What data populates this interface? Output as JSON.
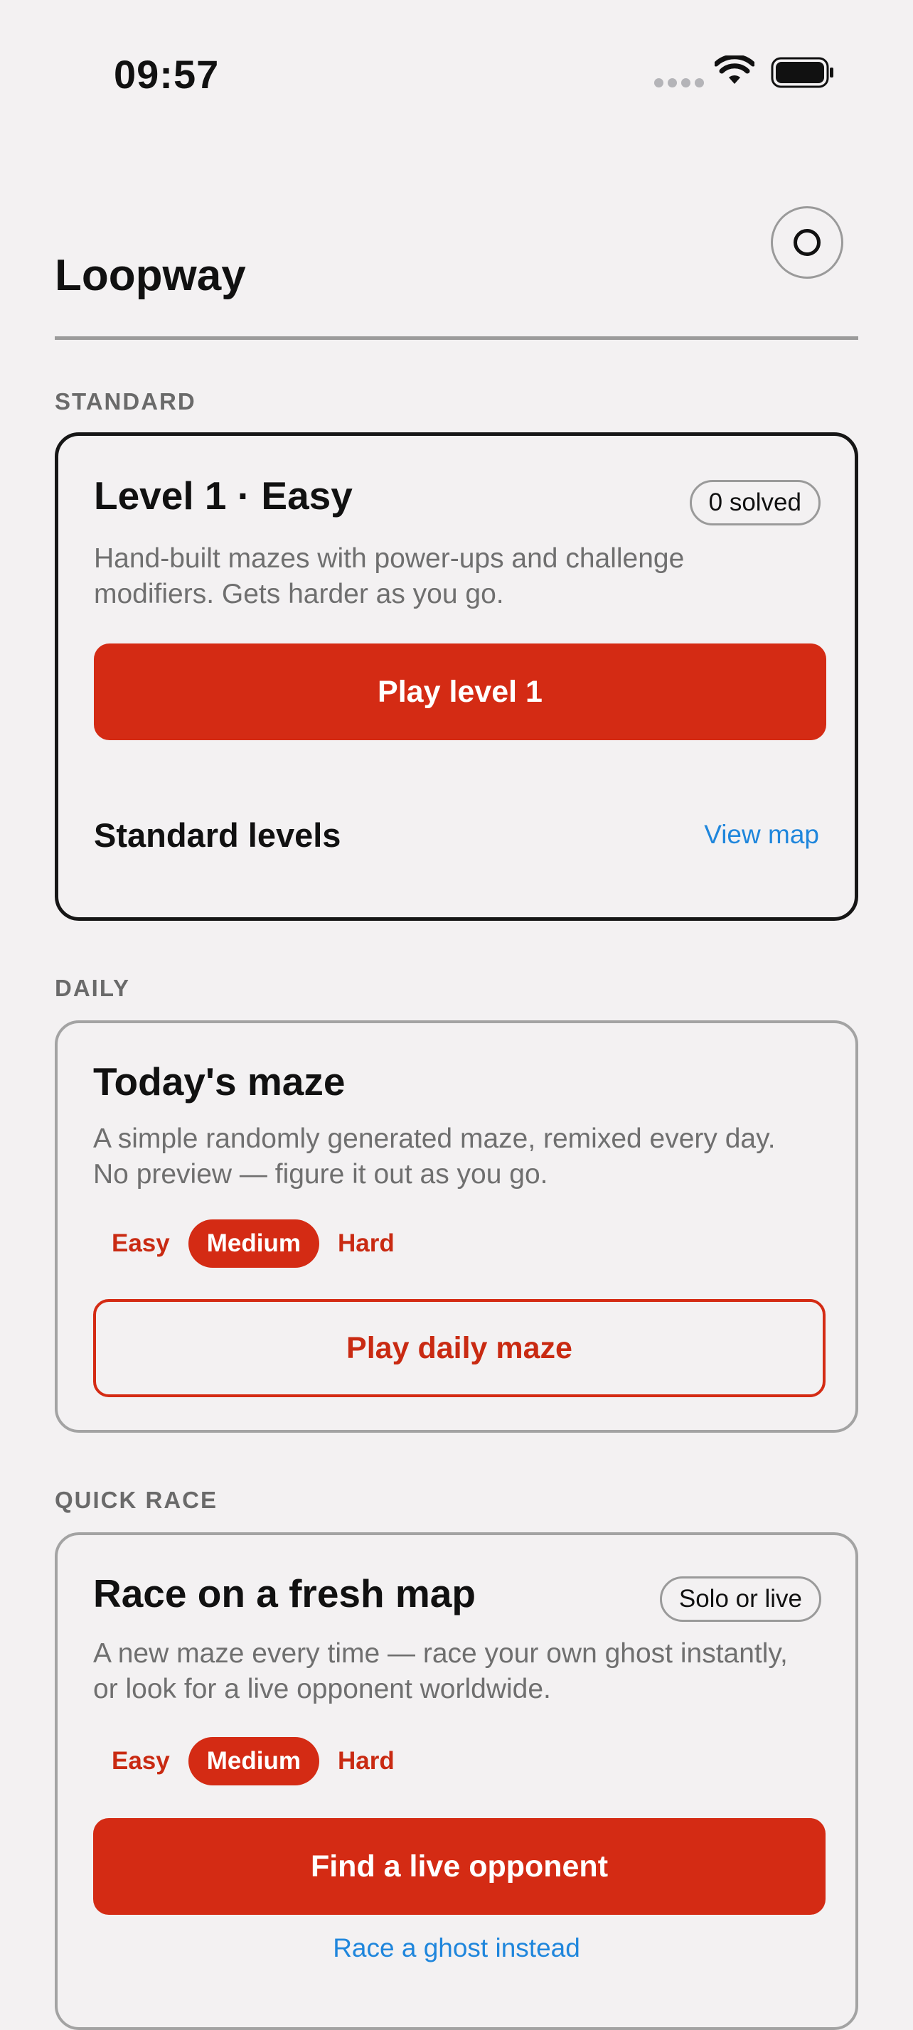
{
  "status_bar": {
    "time": "09:57"
  },
  "header": {
    "title": "Loopway",
    "profile_icon": "profile-circle-icon"
  },
  "sections": {
    "standard": {
      "label": "STANDARD",
      "card_title": "Level 1 · Easy",
      "badge": "0 solved",
      "description": "Hand-built mazes with power-ups and challenge modifiers. Gets harder as you go.",
      "play_button": "Play level 1",
      "levels_title": "Standard levels",
      "view_map_link": "View map"
    },
    "daily": {
      "label": "DAILY",
      "card_title": "Today's maze",
      "description": "A simple randomly generated maze, remixed every day. No preview — figure it out as you go.",
      "difficulty": [
        "Easy",
        "Medium",
        "Hard"
      ],
      "selected_difficulty": "Medium",
      "play_button": "Play daily maze"
    },
    "quick_race": {
      "label": "QUICK RACE",
      "card_title": "Race on a fresh map",
      "badge": "Solo or live",
      "description": "A new maze every time — race your own ghost instantly, or look for a live opponent worldwide.",
      "difficulty": [
        "Easy",
        "Medium",
        "Hard"
      ],
      "selected_difficulty": "Medium",
      "primary_button": "Find a live opponent",
      "ghost_link": "Race a ghost instead"
    }
  },
  "colors": {
    "accent": "#d42b14",
    "link": "#1f86dc",
    "background": "#f3f1f2"
  }
}
